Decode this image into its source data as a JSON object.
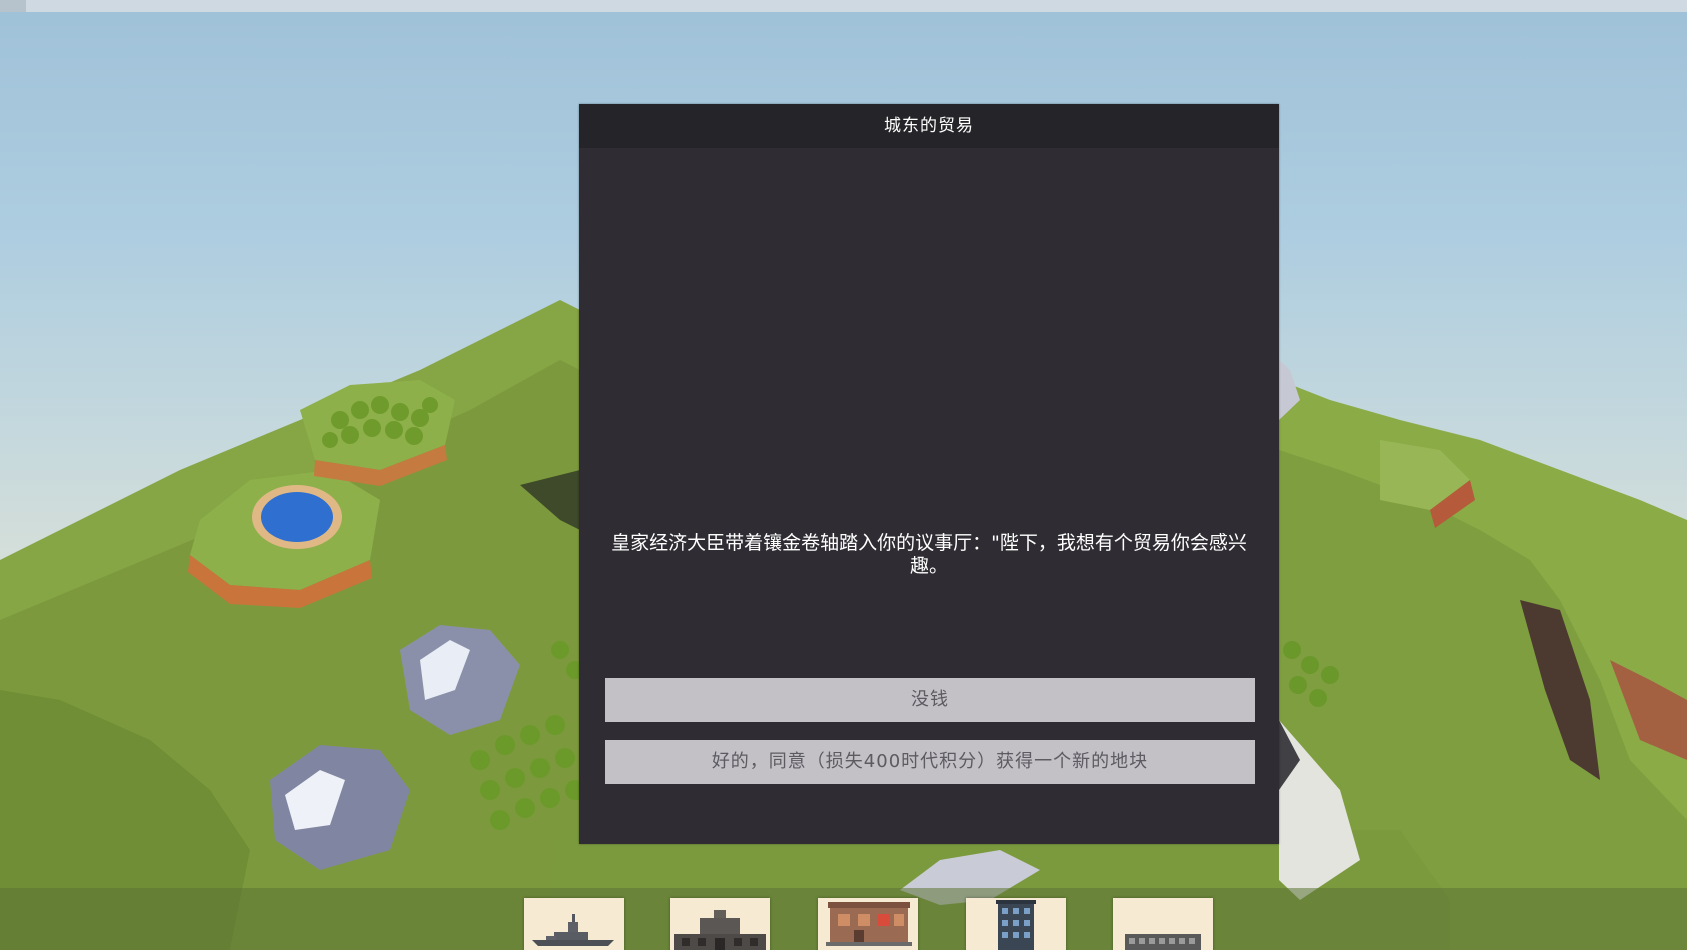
{
  "dialog": {
    "title": "城东的贸易",
    "body": "皇家经济大臣带着镶金卷轴踏入你的议事厅：\"陛下，我想有个贸易你会感兴趣。",
    "choices": [
      {
        "label": "没钱"
      },
      {
        "label": "好的，同意（损失400时代积分）获得一个新的地块"
      }
    ]
  },
  "building_bar": {
    "items": [
      {
        "icon": "warship-icon"
      },
      {
        "icon": "hall-building-icon"
      },
      {
        "icon": "house-building-icon"
      },
      {
        "icon": "tower-building-icon"
      },
      {
        "icon": "factory-building-icon"
      }
    ]
  },
  "colors": {
    "dialog_bg": "#2f2d33",
    "dialog_header_bg": "#252428",
    "button_bg": "#c3c1c6",
    "grass": "#8fae4a",
    "card_bg": "#f6ead2"
  }
}
